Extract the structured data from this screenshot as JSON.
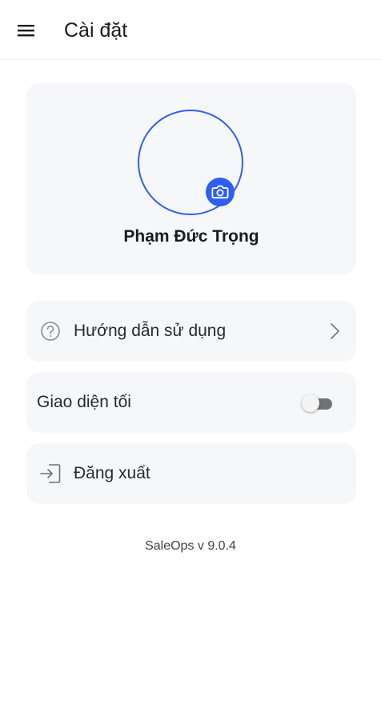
{
  "header": {
    "title": "Cài đặt",
    "menu_icon": "hamburger-menu-icon"
  },
  "profile": {
    "name": "Phạm Đức Trọng",
    "avatar_border_color": "#3060ee",
    "camera_icon": "camera-icon",
    "camera_button_color": "#2f5ff0"
  },
  "menu": {
    "guide": {
      "label": "Hướng dẫn sử dụng",
      "icon": "help-circle-icon",
      "trailing_icon": "chevron-right-icon"
    },
    "dark_mode": {
      "label": "Giao diện tối",
      "enabled": false
    },
    "logout": {
      "label": "Đăng xuất",
      "icon": "logout-icon"
    }
  },
  "footer": {
    "version": "SaleOps v 9.0.4"
  }
}
